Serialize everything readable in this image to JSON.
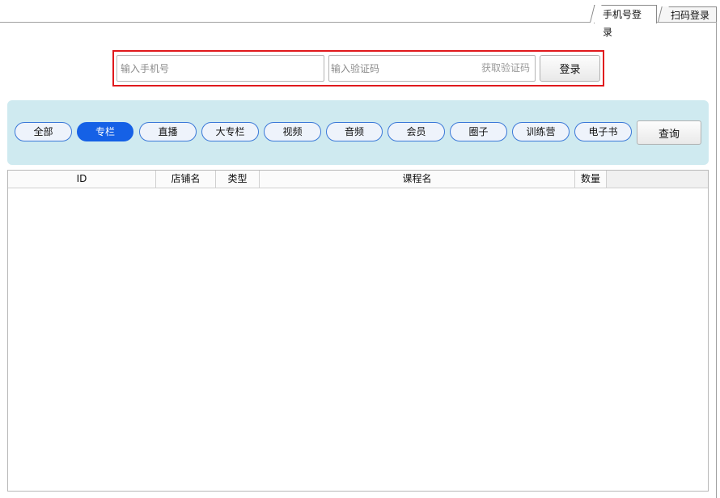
{
  "tabs": [
    {
      "label": "手机号登录",
      "active": true
    },
    {
      "label": "扫码登录",
      "active": false
    }
  ],
  "login": {
    "phone_placeholder": "输入手机号",
    "code_placeholder": "输入验证码",
    "get_code_label": "获取验证码",
    "login_label": "登录"
  },
  "filters": {
    "items": [
      "全部",
      "专栏",
      "直播",
      "大专栏",
      "视频",
      "音频",
      "会员",
      "圈子",
      "训练营",
      "电子书"
    ],
    "active": "专栏",
    "query_label": "查询"
  },
  "table": {
    "columns": [
      "ID",
      "店铺名",
      "类型",
      "课程名",
      "数量"
    ],
    "rows": []
  },
  "colors": {
    "accent": "#1561e6",
    "highlight_border": "#e0191d",
    "filter_bg": "#cfeaf0"
  }
}
